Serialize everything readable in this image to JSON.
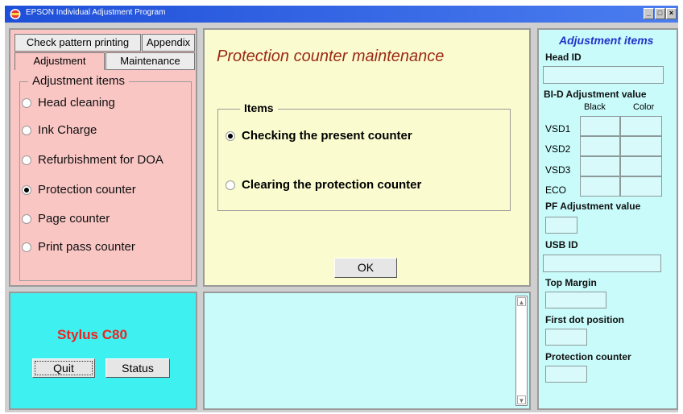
{
  "window": {
    "title": "EPSON Individual Adjustment Program",
    "controls": [
      "_",
      "□",
      "×"
    ]
  },
  "tabs": {
    "check_pattern": "Check pattern printing",
    "appendix": "Appendix",
    "adjustment": "Adjustment",
    "maintenance": "Maintenance"
  },
  "left_panel": {
    "group_title": "Adjustment items",
    "items": [
      {
        "label": "Head cleaning",
        "selected": false
      },
      {
        "label": "Ink Charge",
        "selected": false
      },
      {
        "label": "Refurbishment for DOA",
        "selected": false
      },
      {
        "label": "Protection counter",
        "selected": true
      },
      {
        "label": "Page counter",
        "selected": false
      },
      {
        "label": "Print pass counter",
        "selected": false
      }
    ]
  },
  "model_panel": {
    "model": "Stylus C80",
    "quit_label": "Quit",
    "status_label": "Status"
  },
  "main": {
    "title": "Protection counter maintenance",
    "group_title": "Items",
    "options": [
      {
        "label": "Checking the present counter",
        "selected": true
      },
      {
        "label": "Clearing the protection counter",
        "selected": false
      }
    ],
    "ok_label": "OK"
  },
  "log_panel": {
    "scroll_up": "▲",
    "scroll_down": "▼"
  },
  "right_panel": {
    "title": "Adjustment items",
    "head_id_label": "Head ID",
    "bid_label": "BI-D Adjustment value",
    "col_black": "Black",
    "col_color": "Color",
    "rows": [
      "VSD1",
      "VSD2",
      "VSD3",
      "ECO"
    ],
    "pf_label": "PF Adjustment value",
    "usb_label": "USB ID",
    "top_margin_label": "Top Margin",
    "first_dot_label": "First dot position",
    "protection_label": "Protection counter"
  },
  "colors": {
    "left_panel_bg": "#f9c6c4",
    "main_panel_bg": "#fbfbd0",
    "cyan_bg": "#c9fbfb",
    "model_bg": "#3ff0f0",
    "title_text": "#9a2a14",
    "model_text": "#ee2222",
    "right_title": "#2233cc"
  }
}
